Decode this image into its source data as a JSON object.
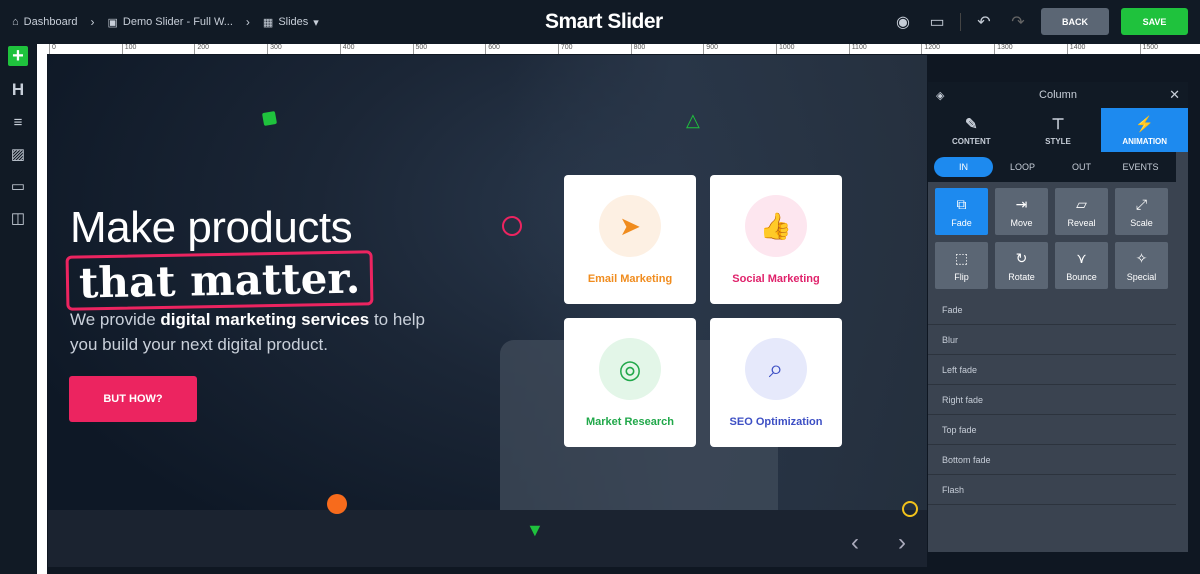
{
  "topbar": {
    "breadcrumb": [
      {
        "label": "Dashboard",
        "icon": "home-icon"
      },
      {
        "label": "Demo Slider - Full W...",
        "icon": "image-icon"
      },
      {
        "label": "Slides",
        "icon": "grid-icon"
      }
    ],
    "logo": "Smart Slider",
    "back": "BACK",
    "save": "SAVE"
  },
  "ruler": [
    "0",
    "100",
    "200",
    "300",
    "400",
    "500",
    "600",
    "700",
    "800",
    "900",
    "1000",
    "1100",
    "1200",
    "1300",
    "1400",
    "1500"
  ],
  "slide": {
    "heading": "Make products",
    "heading_highlight": "that matter.",
    "para_pre": "We provide ",
    "para_bold": "digital marketing services",
    "para_post": " to help you build your next digital product.",
    "cta": "BUT HOW?",
    "cards": [
      {
        "label": "Email Marketing",
        "color": "#f08c1e",
        "bg": "#fdf0e3",
        "icon": "paper-plane-icon"
      },
      {
        "label": "Social Marketing",
        "color": "#e0226b",
        "bg": "#fde6ef",
        "icon": "like-hand-icon"
      },
      {
        "label": "Market Research",
        "color": "#21a84a",
        "bg": "#e3f6e8",
        "icon": "target-icon"
      },
      {
        "label": "SEO Optimization",
        "color": "#3d4fc4",
        "bg": "#e6e9fb",
        "icon": "chart-search-icon"
      }
    ]
  },
  "panel": {
    "title": "Column",
    "tabs": [
      "CONTENT",
      "STYLE",
      "ANIMATION"
    ],
    "subtabs": [
      "IN",
      "LOOP",
      "OUT",
      "EVENTS"
    ],
    "buttons": [
      "Fade",
      "Move",
      "Reveal",
      "Scale",
      "Flip",
      "Rotate",
      "Bounce",
      "Special"
    ],
    "list": [
      "Fade",
      "Blur",
      "Left fade",
      "Right fade",
      "Top fade",
      "Bottom fade",
      "Flash"
    ]
  },
  "colors": {
    "accent": "#1d8aef",
    "save": "#1fc23d",
    "cta": "#ec2460"
  }
}
